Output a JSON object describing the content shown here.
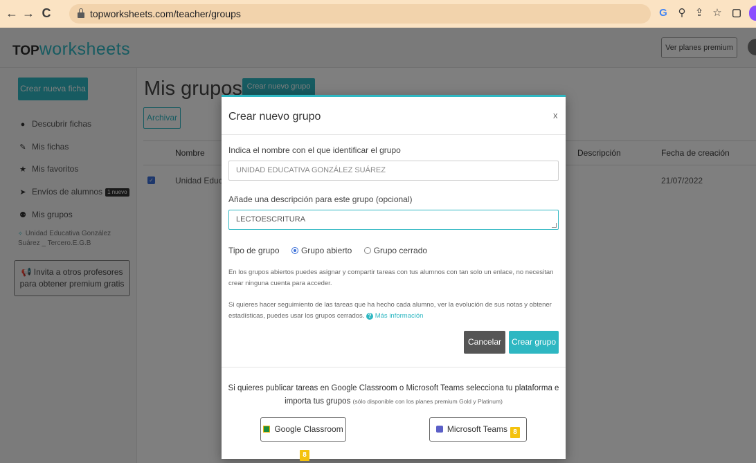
{
  "browser": {
    "url": "topworksheets.com/teacher/groups",
    "back_icon": "←",
    "forward_icon": "→",
    "reload_icon": "C"
  },
  "header": {
    "logo_top": "TOP",
    "logo_rest": "worksheets",
    "premium_button": "Ver planes premium"
  },
  "sidebar": {
    "create_button": "Crear nueva ficha",
    "items": [
      {
        "label": "Descubrir fichas",
        "icon": "compass-icon"
      },
      {
        "label": "Mis fichas",
        "icon": "edit-icon"
      },
      {
        "label": "Mis favoritos",
        "icon": "star-icon"
      },
      {
        "label": "Envíos de alumnos",
        "icon": "send-icon",
        "badge": "1 nuevo"
      },
      {
        "label": "Mis grupos",
        "icon": "users-icon"
      }
    ],
    "group_item": "Unidad Educativa González Suárez _ Tercero.E.G.B",
    "invite": "Invita a otros profesores para obtener premium gratis"
  },
  "main": {
    "title": "Mis grupos",
    "create_button": "Crear nuevo grupo",
    "archive_button": "Archivar",
    "columns": [
      "Nombre",
      "Descripción",
      "Fecha de creación"
    ],
    "rows": [
      {
        "name": "Unidad Educat",
        "date": "21/07/2022"
      }
    ]
  },
  "modal": {
    "title": "Crear nuevo grupo",
    "close": "x",
    "name_label": "Indica el nombre con el que identificar el grupo",
    "name_value": "UNIDAD EDUCATIVA GONZÁLEZ SUÁREZ",
    "desc_label": "Añade una descripción para este grupo (opcional)",
    "desc_value": "LECTOESCRITURA",
    "type_label": "Tipo de grupo",
    "option_open": "Grupo abierto",
    "option_closed": "Grupo cerrado",
    "selected": "Grupo abierto",
    "help_open": "En los grupos abiertos puedes asignar y compartir tareas con tus alumnos con tan solo un enlace, no necesitan crear ninguna cuenta para acceder.",
    "help_closed": "Si quieres hacer seguimiento de las tareas que ha hecho cada alumno, ver la evolución de sus notas y obtener estadísticas, puedes usar los grupos cerrados.",
    "more_info": "Más información",
    "cancel_button": "Cancelar",
    "create_button": "Crear grupo",
    "import_text_1": "Si quieres publicar tareas en Google Classroom o Microsoft Teams selecciona tu plataforma e",
    "import_text_2": "importa tus grupos",
    "import_note": "(sólo disponible con los planes premium Gold y Platinum)",
    "google_button": "Google Classroom",
    "teams_button": "Microsoft Teams"
  }
}
